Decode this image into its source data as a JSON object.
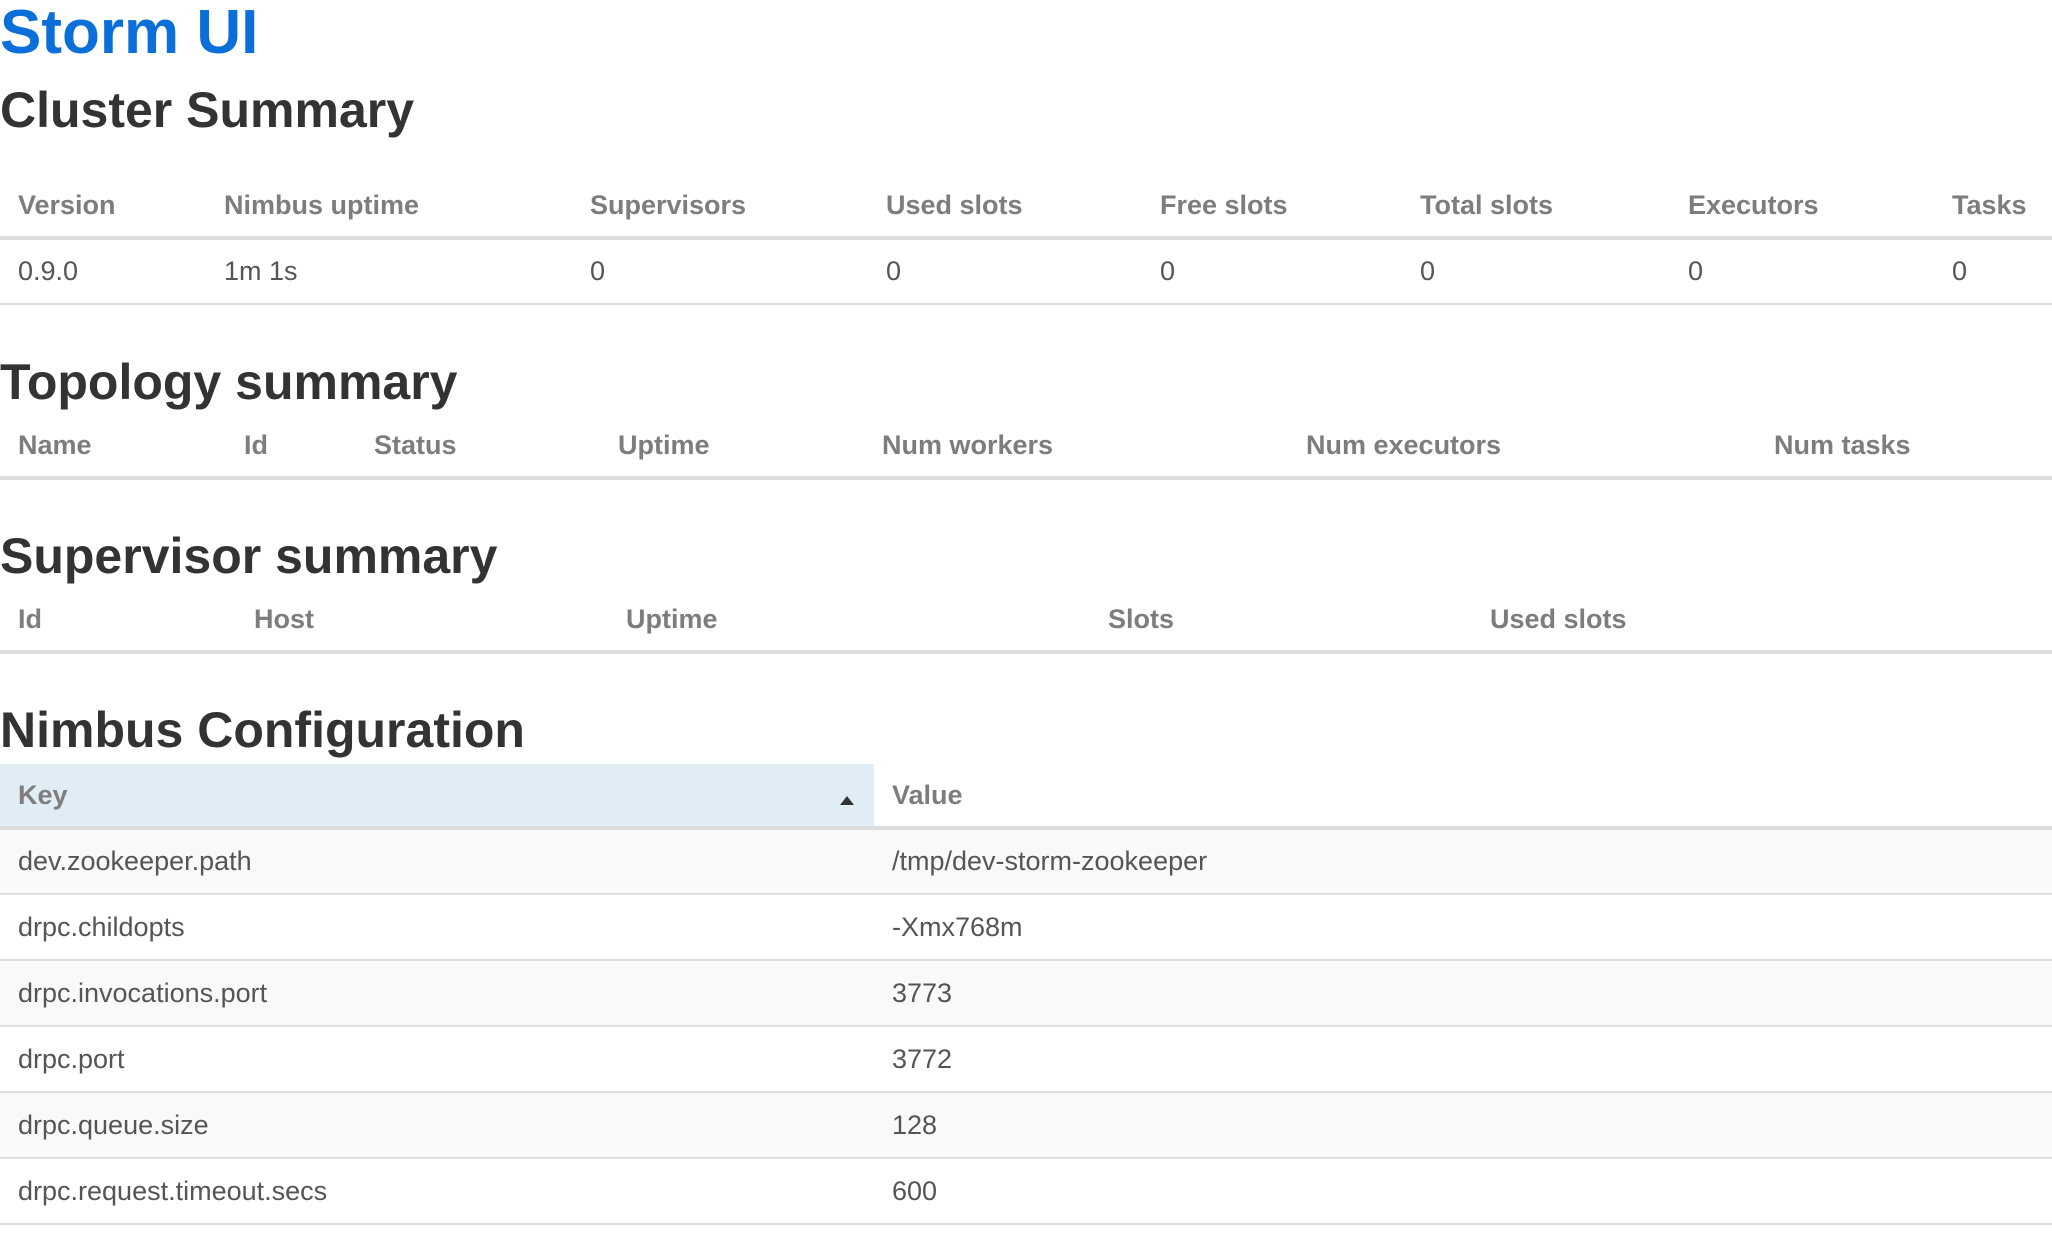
{
  "app": {
    "title": "Storm UI"
  },
  "cluster_summary": {
    "title": "Cluster Summary",
    "columns": [
      "Version",
      "Nimbus uptime",
      "Supervisors",
      "Used slots",
      "Free slots",
      "Total slots",
      "Executors",
      "Tasks"
    ],
    "row": [
      "0.9.0",
      "1m 1s",
      "0",
      "0",
      "0",
      "0",
      "0",
      "0"
    ]
  },
  "topology_summary": {
    "title": "Topology summary",
    "columns": [
      "Name",
      "Id",
      "Status",
      "Uptime",
      "Num workers",
      "Num executors",
      "Num tasks"
    ]
  },
  "supervisor_summary": {
    "title": "Supervisor summary",
    "columns": [
      "Id",
      "Host",
      "Uptime",
      "Slots",
      "Used slots"
    ]
  },
  "nimbus_configuration": {
    "title": "Nimbus Configuration",
    "columns": [
      "Key",
      "Value"
    ],
    "sort": {
      "column": "Key",
      "direction": "ascending",
      "icon": "sort-asc-icon"
    },
    "rows": [
      {
        "key": "dev.zookeeper.path",
        "value": "/tmp/dev-storm-zookeeper"
      },
      {
        "key": "drpc.childopts",
        "value": "-Xmx768m"
      },
      {
        "key": "drpc.invocations.port",
        "value": "3773"
      },
      {
        "key": "drpc.port",
        "value": "3772"
      },
      {
        "key": "drpc.queue.size",
        "value": "128"
      },
      {
        "key": "drpc.request.timeout.secs",
        "value": "600"
      }
    ]
  },
  "colors": {
    "title_link": "#0a6fd8",
    "sorted_header_bg": "#e1edf4",
    "striped_row_bg": "#f9f9f9"
  }
}
